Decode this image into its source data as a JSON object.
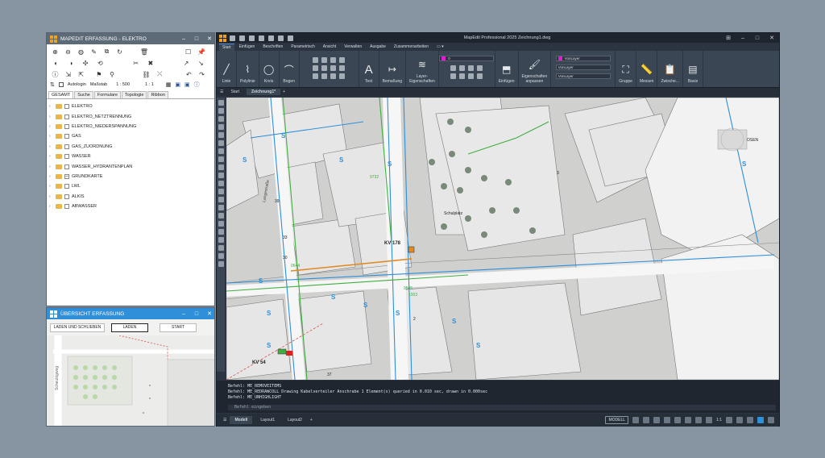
{
  "mapedit": {
    "title": "MAPEDIT ERFASSUNG - ELEKTRO",
    "options": {
      "autologin_label": "Autologin",
      "massstab_label": "Maßstab",
      "massstab_value": "1 : 500",
      "ratio_value": "1 : 1"
    },
    "tabs": [
      "GESAMT",
      "Suche",
      "Formulare",
      "Topologie",
      "Ribbon"
    ],
    "tree": [
      "ELEKTRO",
      "ELEKTRO_NETZTRENNUNG",
      "ELEKTRO_NIEDERSPANNUNG",
      "GAS",
      "GAS_ZUORDNUNG",
      "WASSER",
      "WASSER_HYDRANTENPLAN",
      "GRUNDKARTE",
      "LWL",
      "ALKIS",
      "ABWASSER"
    ]
  },
  "uebersicht": {
    "title": "ÜBERSICHT ERFASSUNG",
    "buttons": [
      "LADEN UND SCHLIEBEN",
      "LADEN",
      "START"
    ],
    "street": "Scheubigweg"
  },
  "cad": {
    "title": "MapEdit Professional 2025   Zeichnung1.dwg",
    "ribbon_tabs": [
      "Start",
      "Einfügen",
      "Beschriften",
      "Parametrisch",
      "Ansicht",
      "Verwalten",
      "Ausgabe",
      "Zusammenarbeiten"
    ],
    "groups": {
      "linie": "Linie",
      "polylinie": "Polylinie",
      "kreis": "Kreis",
      "bogen": "Bogen",
      "text": "Text",
      "bemassung": "Bemaßung",
      "layer": "Layer-\nEigenschaften",
      "einfuegen": "Einfügen",
      "eigenschaften": "Eigenschaften\nanpassen",
      "gruppe": "Gruppe",
      "messen": "Messen",
      "zwischen": "Zwische...",
      "basis": "Basis"
    },
    "layer_value": "0",
    "vonlayer": "VonLayer",
    "doc_tabs": [
      "Start",
      "Zeichnung1*"
    ],
    "command_lines": [
      "Befehl: ME_REMOVEITEMS",
      "Befehl: ME_REDRAWCOLL  Drawing Kabelverteiler Anschrabe 1 Element(s) queried in 0.010 sec, drawn in 0.000sec",
      "Befehl: ME_UNHIGHLIGHT"
    ],
    "command_placeholder": "Befehl eingeben",
    "layout_tabs": [
      "Modell",
      "Layout1",
      "Layout2"
    ],
    "status_modell": "MODELL",
    "status_scale": "1:1"
  },
  "map": {
    "labels": {
      "kv178": "KV 178",
      "kv54": "KV 54",
      "schulplatz": "Schulplatz",
      "langestrasse": "Langestraße",
      "ost": "OSEN",
      "n1003": "1003",
      "n9505": "9505",
      "n0644": "0644",
      "n9732": "9732",
      "h33": "33",
      "h30": "30",
      "h2": "2",
      "h3": "3",
      "h37": "37",
      "h39": "39"
    }
  },
  "colors": {
    "cad_bg": "#2b3440",
    "drawing_bg": "#d0d0cf",
    "cable_blue": "#2f8fd8",
    "cable_green": "#3fae3f",
    "cable_orange": "#e08a20"
  }
}
